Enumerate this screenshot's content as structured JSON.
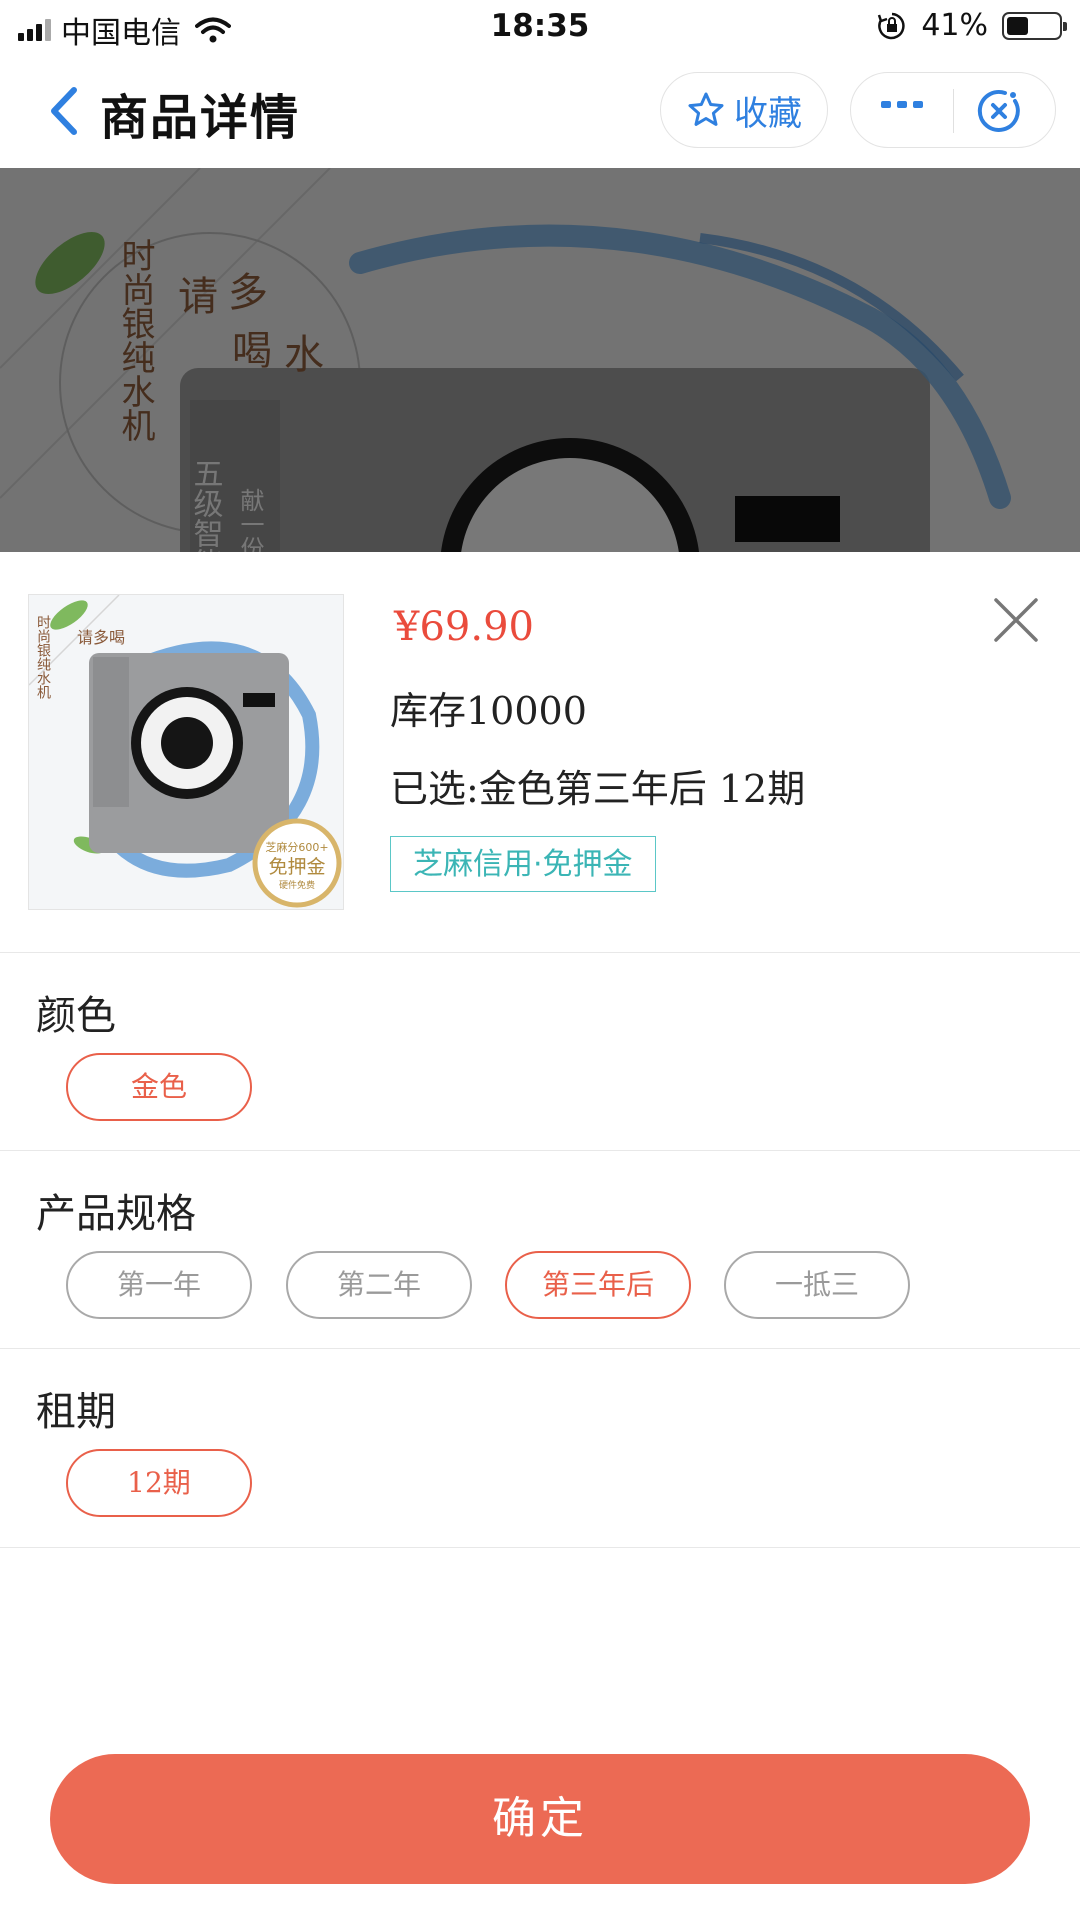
{
  "status_bar": {
    "carrier": "中国电信",
    "time": "18:35",
    "battery_percent": "41%",
    "battery_level": 0.41
  },
  "nav": {
    "title": "商品详情",
    "favorite_label": "收藏"
  },
  "banner": {
    "texts": [
      "时尚银纯水机",
      "请多喝水",
      "五级智能",
      "献一份"
    ]
  },
  "product": {
    "price": "¥69.90",
    "stock": "库存10000",
    "selected": "已选:金色第三年后 12期",
    "badge": "芝麻信用·免押金",
    "thumb_texts": {
      "vertical": "时尚银纯水机",
      "slogan": "请多喝",
      "seal_score": "芝麻分600+",
      "seal_main": "免押金",
      "seal_sub": "硬件免费"
    }
  },
  "sections": [
    {
      "title": "颜色",
      "options": [
        {
          "label": "金色",
          "selected": true
        }
      ]
    },
    {
      "title": "产品规格",
      "options": [
        {
          "label": "第一年",
          "selected": false
        },
        {
          "label": "第二年",
          "selected": false
        },
        {
          "label": "第三年后",
          "selected": true
        },
        {
          "label": "一抵三",
          "selected": false
        }
      ]
    },
    {
      "title": "租期",
      "options": [
        {
          "label": "12期",
          "selected": true
        }
      ]
    }
  ],
  "confirm_label": "确定",
  "colors": {
    "accent": "#ec6a54",
    "price": "#ea4b3c",
    "link_blue": "#2f80e0",
    "badge_teal": "#3bb5b5"
  }
}
